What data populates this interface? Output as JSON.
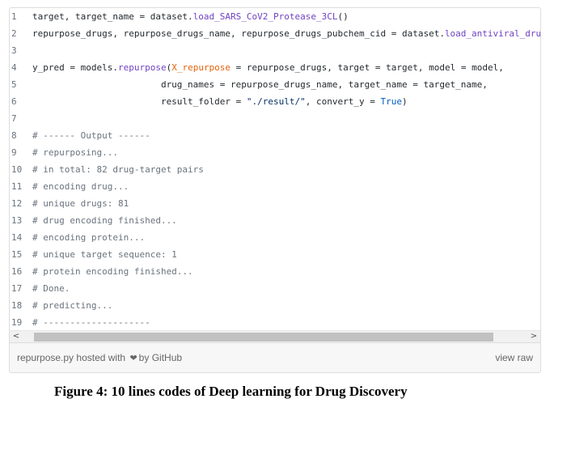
{
  "code": {
    "lines": [
      {
        "n": "1",
        "tokens": [
          {
            "t": "target, target_name = dataset.",
            "c": ""
          },
          {
            "t": "load_SARS_CoV2_Protease_3CL",
            "c": "tok-prop"
          },
          {
            "t": "()",
            "c": ""
          }
        ]
      },
      {
        "n": "2",
        "tokens": [
          {
            "t": "repurpose_drugs, repurpose_drugs_name, repurpose_drugs_pubchem_cid = dataset.",
            "c": ""
          },
          {
            "t": "load_antiviral_drugs",
            "c": "tok-prop"
          }
        ]
      },
      {
        "n": "3",
        "tokens": []
      },
      {
        "n": "4",
        "tokens": [
          {
            "t": "y_pred = models.",
            "c": ""
          },
          {
            "t": "repurpose",
            "c": "tok-prop"
          },
          {
            "t": "(",
            "c": ""
          },
          {
            "t": "X_repurpose",
            "c": "tok-arg"
          },
          {
            "t": " = repurpose_drugs, target = target, model = model,",
            "c": ""
          }
        ]
      },
      {
        "n": "5",
        "tokens": [
          {
            "t": "                        drug_names = repurpose_drugs_name, target_name = target_name,",
            "c": ""
          }
        ]
      },
      {
        "n": "6",
        "tokens": [
          {
            "t": "                        result_folder = ",
            "c": ""
          },
          {
            "t": "\"./result/\"",
            "c": "tok-str"
          },
          {
            "t": ", convert_y = ",
            "c": ""
          },
          {
            "t": "True",
            "c": "tok-const"
          },
          {
            "t": ")",
            "c": ""
          }
        ]
      },
      {
        "n": "7",
        "tokens": []
      },
      {
        "n": "8",
        "tokens": [
          {
            "t": "# ------ Output ------",
            "c": "tok-cmt"
          }
        ]
      },
      {
        "n": "9",
        "tokens": [
          {
            "t": "# repurposing...",
            "c": "tok-cmt"
          }
        ]
      },
      {
        "n": "10",
        "tokens": [
          {
            "t": "# in total: 82 drug-target pairs",
            "c": "tok-cmt"
          }
        ]
      },
      {
        "n": "11",
        "tokens": [
          {
            "t": "# encoding drug...",
            "c": "tok-cmt"
          }
        ]
      },
      {
        "n": "12",
        "tokens": [
          {
            "t": "# unique drugs: 81",
            "c": "tok-cmt"
          }
        ]
      },
      {
        "n": "13",
        "tokens": [
          {
            "t": "# drug encoding finished...",
            "c": "tok-cmt"
          }
        ]
      },
      {
        "n": "14",
        "tokens": [
          {
            "t": "# encoding protein...",
            "c": "tok-cmt"
          }
        ]
      },
      {
        "n": "15",
        "tokens": [
          {
            "t": "# unique target sequence: 1",
            "c": "tok-cmt"
          }
        ]
      },
      {
        "n": "16",
        "tokens": [
          {
            "t": "# protein encoding finished...",
            "c": "tok-cmt"
          }
        ]
      },
      {
        "n": "17",
        "tokens": [
          {
            "t": "# Done.",
            "c": "tok-cmt"
          }
        ]
      },
      {
        "n": "18",
        "tokens": [
          {
            "t": "# predicting...",
            "c": "tok-cmt"
          }
        ]
      },
      {
        "n": "19",
        "tokens": [
          {
            "t": "# --------------------",
            "c": "tok-cmt"
          }
        ]
      }
    ]
  },
  "scrollbar": {
    "left_arrow": "<",
    "right_arrow": ">"
  },
  "meta": {
    "filename": "repurpose.py",
    "hosted_with": "hosted with",
    "heart_glyph": "❤",
    "by": "by",
    "host": "GitHub",
    "view_raw": "view raw"
  },
  "caption": "Figure 4: 10 lines codes of Deep learning for Drug Discovery"
}
